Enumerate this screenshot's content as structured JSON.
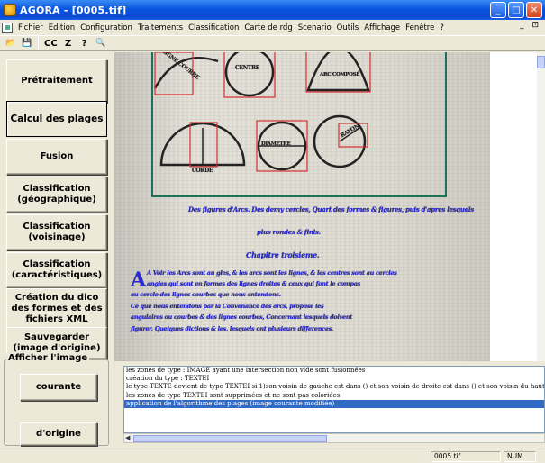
{
  "window": {
    "title": "AGORA - [0005.tif]",
    "controls": [
      "_",
      "□",
      "✕"
    ]
  },
  "menubar": {
    "items": [
      "Fichier",
      "Edition",
      "Configuration",
      "Traitements",
      "Classification",
      "Carte de rdg",
      "Scenario",
      "Outils",
      "Affichage",
      "Fenêtre",
      "?"
    ],
    "right_controls": "_ ⊡"
  },
  "toolbar": {
    "buttons": [
      {
        "name": "open-icon",
        "glyph": "📂"
      },
      {
        "name": "save-icon",
        "glyph": "💾"
      },
      {
        "name": "cc-button",
        "glyph": "CC"
      },
      {
        "name": "z-button",
        "glyph": "Z"
      },
      {
        "name": "help-icon",
        "glyph": "?"
      },
      {
        "name": "zoom-icon",
        "glyph": "🔍"
      }
    ]
  },
  "sidebar": {
    "buttons": [
      {
        "label": "Prétraitement"
      },
      {
        "label": "Calcul des plages"
      },
      {
        "label": "Fusion"
      },
      {
        "label": "Classification (géographique)"
      },
      {
        "label": "Classification (voisinage)"
      },
      {
        "label": "Classification (caractéristiques)"
      },
      {
        "label": "Création du dico des formes et des fichiers XML"
      },
      {
        "label": "Sauvegarder (image d'origine)"
      }
    ],
    "group_title": "Afficher l'image",
    "group_buttons": [
      {
        "label": "courante"
      },
      {
        "label": "d'origine"
      }
    ]
  },
  "document": {
    "shapes": [
      "LIGNE COURBE",
      "CENTRE",
      "ARC COMPOSÉ",
      "CORDE",
      "DIAMETRE",
      "RAYON"
    ],
    "caption_lines": [
      "Des figures d'Arcs. Des demy cercles, Quart des formes & figures, puis d'apres lesquels",
      "plus rondes & finis.",
      "Chapitre troisieme."
    ],
    "body_lines": [
      "A Voir les Arcs sont au gles, & les arcs sont les lignes, & les centres sont au cercles",
      "angles qui sont en formes des lignes droites & ceux qui font le compas",
      "au cercle des lignes courbes que nous entendons.",
      "Ce que nous entendons par la Convenance des arcs, propose les",
      "angulaires ou courbes & des lignes courbes, Concernant lesquels doivent",
      "figurer. Quelques dictions & les, lesquels ont plusieurs differences."
    ]
  },
  "log": {
    "lines": [
      "les zones de type : IMAGE ayant une intersection non vide sont fusionnées",
      "création du type : TEXTEI",
      "le type TEXTE devient de type TEXTEI si 1)son voisin de gauche est dans () et son voisin de droite est dans () et son voisin du haut",
      "les zones de type TEXTEI sont supprimées et  ne sont pas coloriées",
      "application de l'algorithme des plages (image courante modifiée)"
    ],
    "selected_index": 4
  },
  "status": {
    "file": "0005.tif",
    "mode": "NUM"
  },
  "colors": {
    "titlebar": "#0a54e0",
    "selection": "#316ac5",
    "box_outline": "#d23030",
    "frame": "#1e6f5c",
    "text_overlay": "#2a2ad8"
  }
}
